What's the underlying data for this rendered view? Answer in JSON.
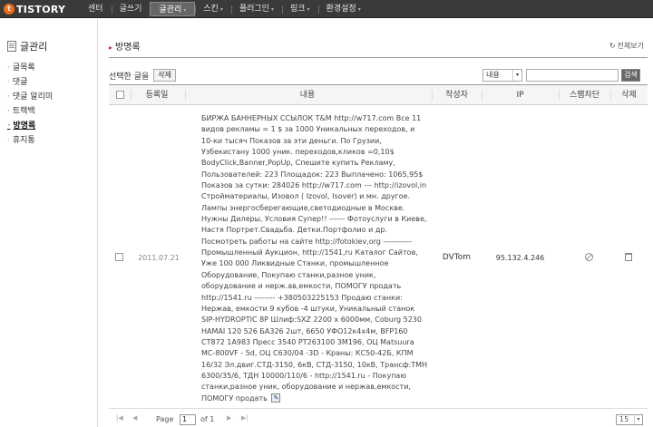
{
  "topbar": {
    "logo_text": "TISTORY",
    "logo_mark": "t",
    "nav": [
      "센터",
      "글쓰기",
      "글관리",
      "스킨",
      "플러그인",
      "링크",
      "환경설정"
    ],
    "nav_caret": "▾"
  },
  "sidebar": {
    "title": "글관리",
    "items": [
      "글목록",
      "댓글",
      "댓글 알리미",
      "트랙백",
      "방명록",
      "휴지통"
    ],
    "active_index": 4
  },
  "main": {
    "title": "방명록",
    "view_all": "전체보기",
    "view_all_icon": "↻",
    "selected_label": "선택한 글을",
    "delete_button": "삭제",
    "filter_select": "내용",
    "search_placeholder": "",
    "search_button": "검색"
  },
  "table": {
    "columns": [
      "등록일",
      "내용",
      "작성자",
      "IP",
      "스팸차단",
      "삭제"
    ],
    "rows": [
      {
        "date": "2011.07.21",
        "content": "БИРЖА БАННЕРНЫХ ССЫЛОК T&M http://w717.com Все 11 видов рекламы = 1 $ за 1000 Уникальных переходов, и 10-ки тысяч Показов за эти деньги. По Грузии, Узбекистану 1000 уник. переходов,кликов =0,10$ BodyClick,Banner,PopUp, Спешите купить Рекламу, Пользователей: 223 Площадок: 223 Выплачено: 1065,95$ Показов за сутки: 284026 http://w717.com --- http://izovol,in Стройматериалы, Изовол ( Izovol, Isover) и мн. другое. Лампы энергосберегающие,светодиодные в Москве. Нужны Дилеры, Условия Супер!! ------ Фотоуслуги в Киеве, Настя Портрет.Свадьба. Детки.Портфолио и др. Посмотреть работы на сайте http://fotokiev,org ----------- Промышленный Аукцион, http://1541,ru Каталог Сайтов, Уже 100 000 Ликвидные Станки, промышленное Оборудование, Покупаю станки,разное уник, оборудование и нерж.ав,емкости, ПОМОГУ продать http://1541.ru -------- +380503225153 Продаю станки: Нержав, емкости 9 кубов -4 штуки, Уникальный станок SIP-HYDROPTIC 8P Шлиф:SXZ 2200 x 6000мм, Coburg 5230 HAMAI 120 526 БА326 2шт, 6650 УФО12к4х4м, BFP160 СТ872 1А983 Пресс 3540 РТ263100 ЗМ196, ОЦ Matsuura MC-800VF - 5d, ОЦ С630/04 -3D - Краны: КС50-42Б, КПМ 16/32 Эл.двиг.СТД-3150, 6кВ, СТД-3150, 10кВ, Трансф:ТМН 6300/35/6, ТДН 10000/110/6 - http://1541.ru - Покупаю станки,разное уник, оборудование и нержав,емкости, ПОМОГУ продать",
        "author": "DVTom",
        "ip": "95.132.4.246"
      }
    ]
  },
  "pager": {
    "page_label": "Page",
    "page_value": "1",
    "of_label": "of 1",
    "rows_per_page": "15"
  }
}
